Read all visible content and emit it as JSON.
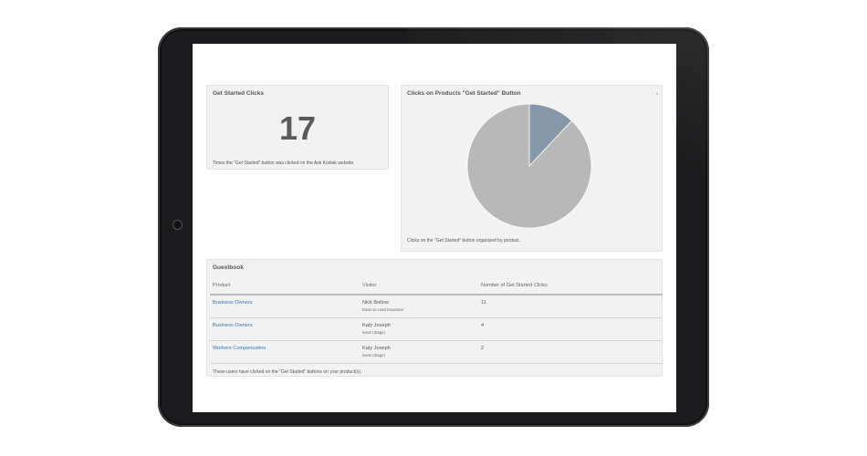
{
  "dashboard": {
    "clicks_card": {
      "title": "Get Started Clicks",
      "count": "17",
      "caption": "Times the \"Get Started\" button was clicked on the Ask Kodiak website."
    },
    "pie_card": {
      "title": "Clicks on Products \"Get Started\" Button",
      "caption": "Clicks on the \"Get Started\" button organized by product."
    },
    "guestbook": {
      "title": "Guestbook",
      "columns": [
        "Product",
        "Visitor",
        "Number of Get Started Clicks"
      ],
      "rows": [
        {
          "product": "Business Owners",
          "visitor": "Nick Bollow",
          "visitor_sub": "Down to Lead Insurance",
          "clicks": "11"
        },
        {
          "product": "Business Owners",
          "visitor": "Katy Joseph",
          "visitor_sub": "Ivans (Stage)",
          "clicks": "4"
        },
        {
          "product": "Workers Compensation",
          "visitor": "Katy Joseph",
          "visitor_sub": "Ivans (Stage)",
          "clicks": "2"
        }
      ],
      "footer": "These users have clicked on the \"Get Started\" buttons on your product(s)."
    }
  },
  "chart_data": {
    "type": "pie",
    "slices": [
      {
        "fraction": 0.88,
        "color": "#b8b8b8"
      },
      {
        "fraction": 0.12,
        "color": "#8697a8"
      }
    ],
    "legend": "none"
  }
}
